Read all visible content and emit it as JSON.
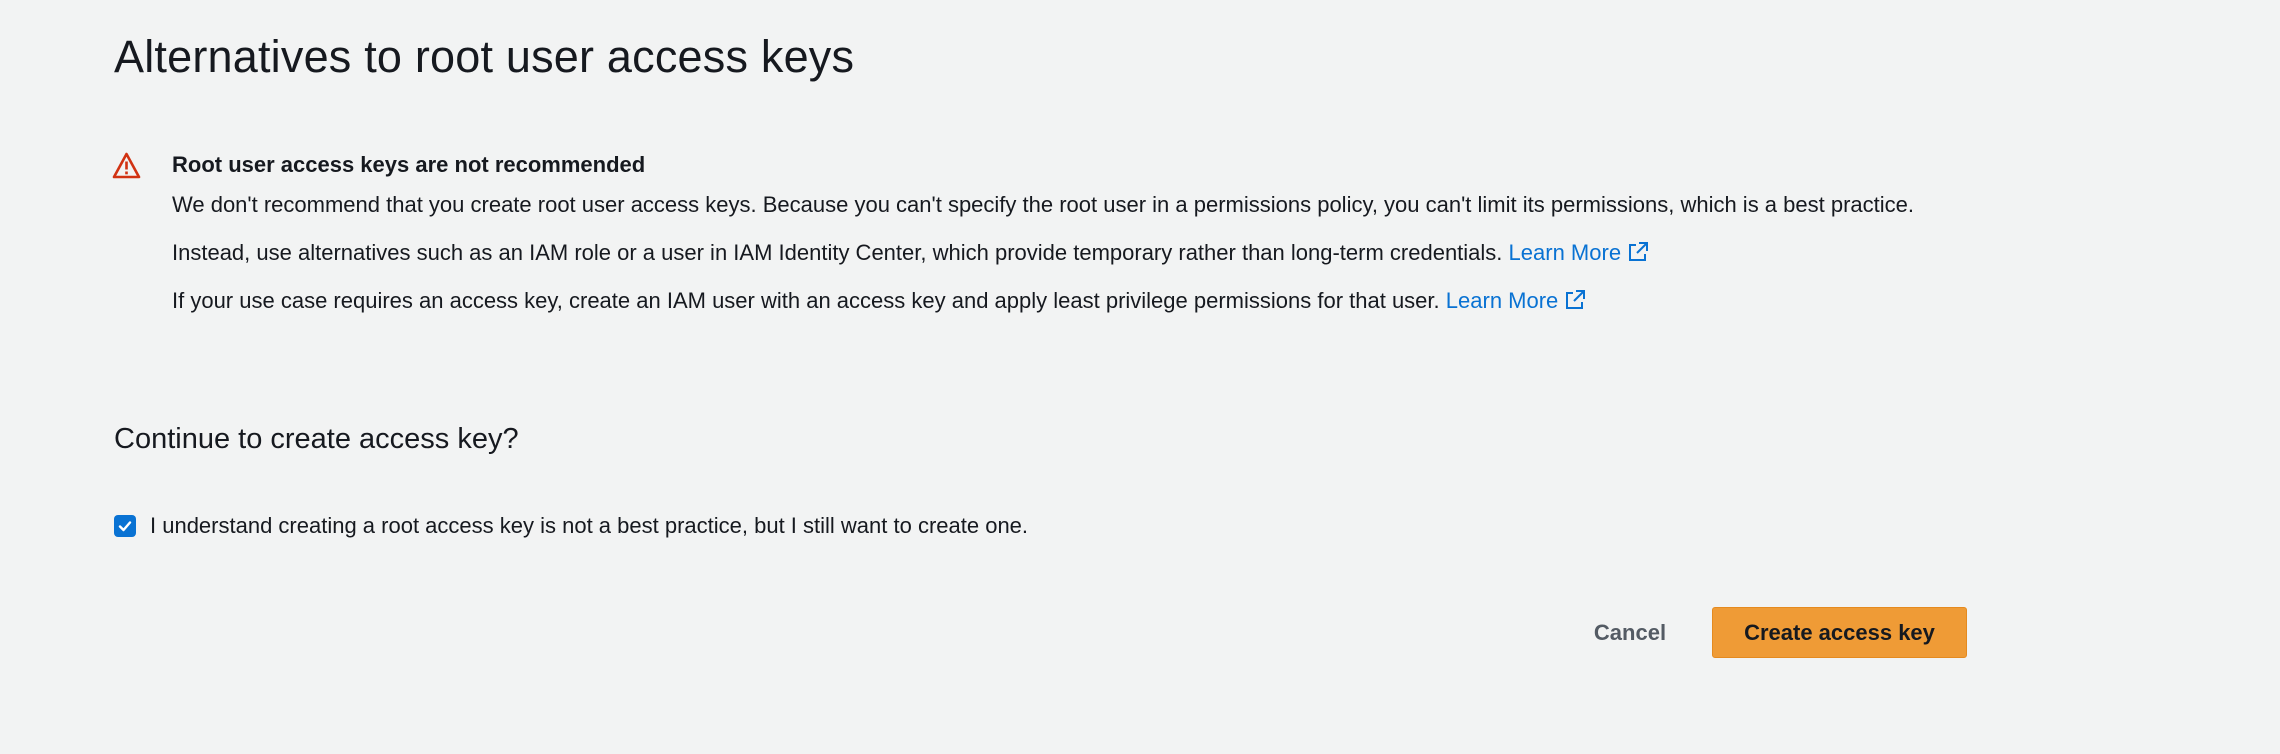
{
  "page": {
    "title": "Alternatives to root user access keys"
  },
  "alert": {
    "icon": "warning-triangle-icon",
    "heading": "Root user access keys are not recommended",
    "paragraph1": "We don't recommend that you create root user access keys. Because you can't specify the root user in a permissions policy, you can't limit its permissions, which is a best practice.",
    "paragraph2_text": "Instead, use alternatives such as an IAM role or a user in IAM Identity Center, which provide temporary rather than long-term credentials.",
    "paragraph2_link": "Learn More",
    "paragraph3_text": "If your use case requires an access key, create an IAM user with an access key and apply least privilege permissions for that user.",
    "paragraph3_link": "Learn More",
    "link_icon": "external-link-icon"
  },
  "confirm": {
    "title": "Continue to create access key?",
    "checkbox_label": "I understand creating a root access key is not a best practice, but I still want to create one.",
    "checkbox_checked": true
  },
  "actions": {
    "cancel_label": "Cancel",
    "create_label": "Create access key"
  },
  "colors": {
    "background": "#f2f3f3",
    "warning": "#d13212",
    "link": "#0972d3",
    "primary_button": "#ef9b36",
    "checkbox": "#0972d3"
  }
}
